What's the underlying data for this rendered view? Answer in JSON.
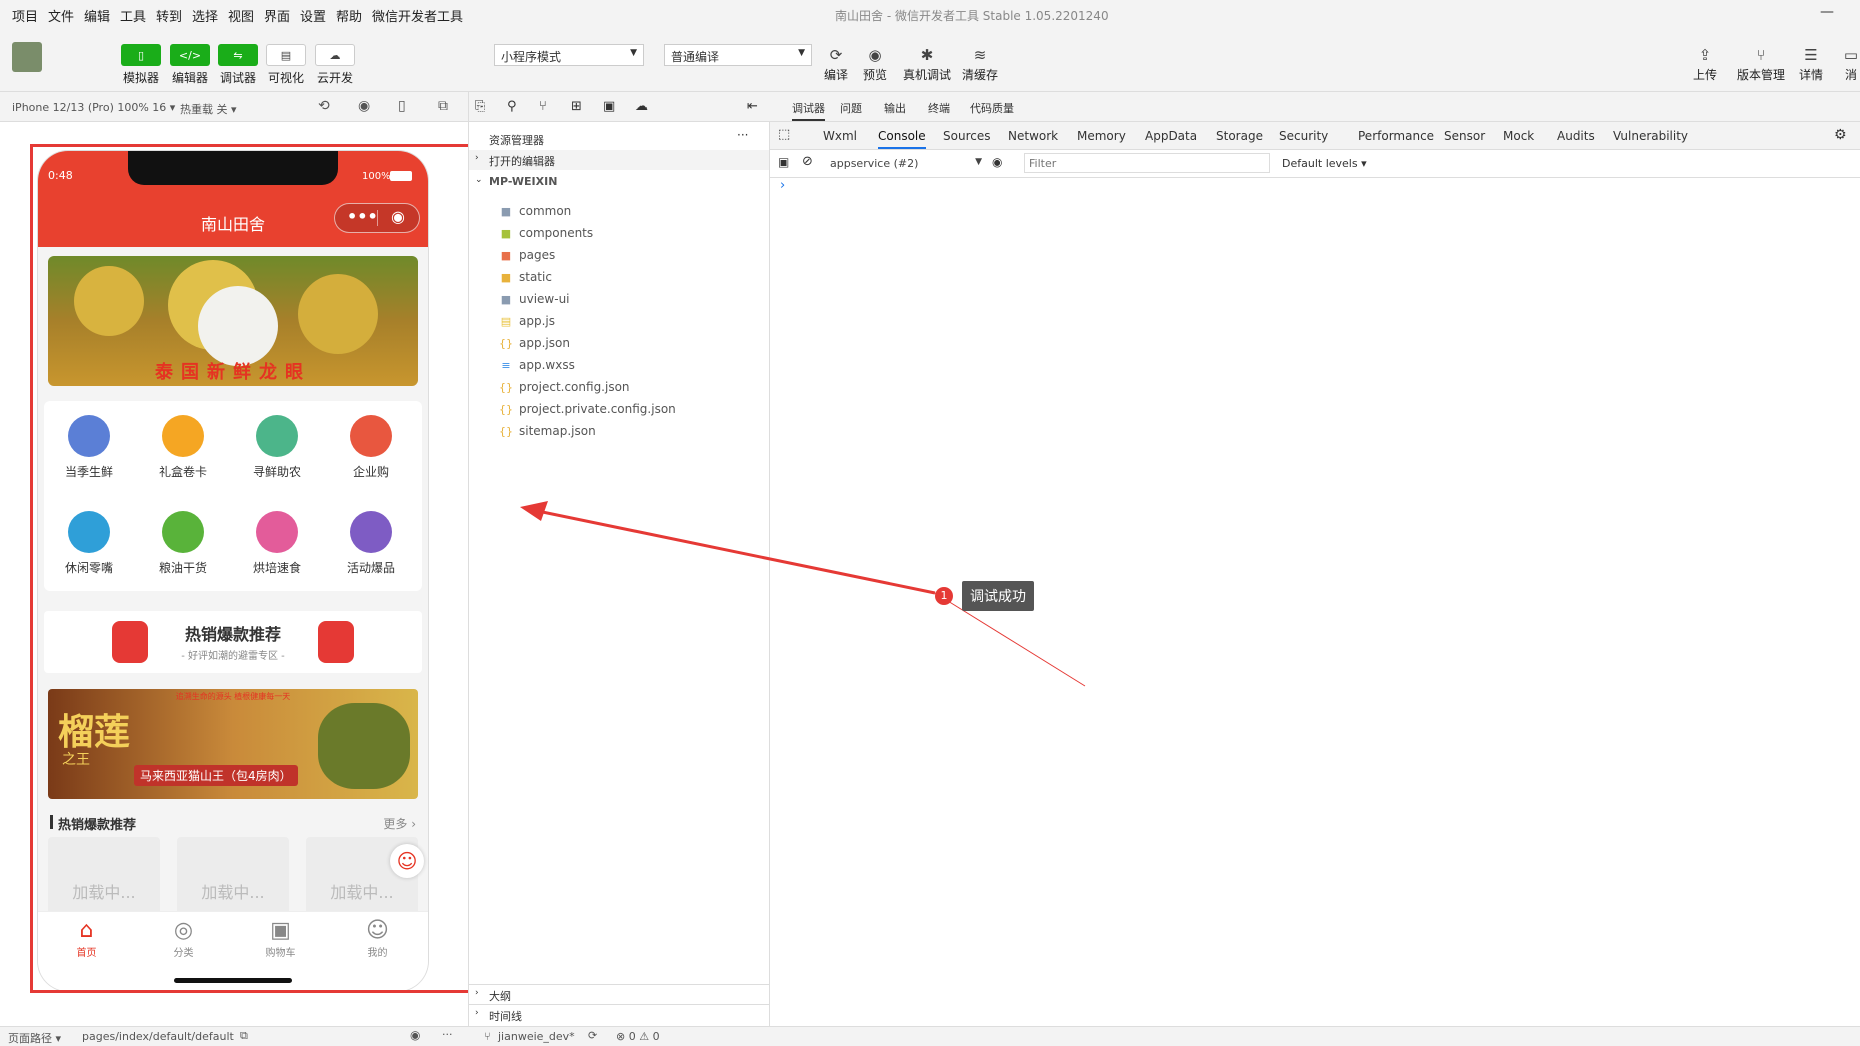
{
  "menu": [
    "项目",
    "文件",
    "编辑",
    "工具",
    "转到",
    "选择",
    "视图",
    "界面",
    "设置",
    "帮助",
    "微信开发者工具"
  ],
  "window_title": "南山田舍 - 微信开发者工具 Stable 1.05.2201240",
  "toolbar": {
    "simulator": "模拟器",
    "editor": "编辑器",
    "debugger": "调试器",
    "visual": "可视化",
    "cloud": "云开发",
    "mode_select": "小程序模式",
    "compile_select": "普通编译",
    "compile": "编译",
    "preview": "预览",
    "real_debug": "真机调试",
    "clear_cache": "清缓存",
    "upload": "上传",
    "version": "版本管理",
    "details": "详情",
    "msg": "消"
  },
  "sim_bar": {
    "device": "iPhone 12/13 (Pro) 100% 16 ▾",
    "hotreload": "热重载 关 ▾"
  },
  "phone": {
    "time": "0:48",
    "battery": "100%",
    "title": "南山田舍",
    "banner1_text": "泰国新鲜龙眼",
    "categories": [
      {
        "label": "当季生鲜",
        "color": "#5b7fd6"
      },
      {
        "label": "礼盒卷卡",
        "color": "#f5a623"
      },
      {
        "label": "寻鲜助农",
        "color": "#4cb58a"
      },
      {
        "label": "企业购",
        "color": "#e8573f"
      },
      {
        "label": "休闲零嘴",
        "color": "#2f9fd8"
      },
      {
        "label": "粮油干货",
        "color": "#59b33a"
      },
      {
        "label": "烘培速食",
        "color": "#e35c9a"
      },
      {
        "label": "活动爆品",
        "color": "#7e5cc4"
      }
    ],
    "hot_title": "热销爆款推荐",
    "hot_sub": "- 好评如潮的避雷专区 -",
    "banner2_top": "追溯生命的源头  植根健康每一天",
    "banner2_big": "榴莲",
    "banner2_small": "之王",
    "banner2_tag": "马来西亚猫山王（包4房肉）",
    "section_title": "热销爆款推荐",
    "more": "更多 ›",
    "loading": "加载中...",
    "tabs": [
      {
        "label": "首页",
        "icon": "⌂"
      },
      {
        "label": "分类",
        "icon": "◎"
      },
      {
        "label": "购物车",
        "icon": "▣"
      },
      {
        "label": "我的",
        "icon": "☺"
      }
    ]
  },
  "explorer": {
    "title": "资源管理器",
    "open_editors": "打开的编辑器",
    "root": "MP-WEIXIN",
    "files": [
      {
        "name": "common",
        "type": "folder",
        "color": "#8a9bb0"
      },
      {
        "name": "components",
        "type": "folder",
        "color": "#a6c23b"
      },
      {
        "name": "pages",
        "type": "folder",
        "color": "#e8704a"
      },
      {
        "name": "static",
        "type": "folder",
        "color": "#e8b23b"
      },
      {
        "name": "uview-ui",
        "type": "folder",
        "color": "#8a9bb0"
      },
      {
        "name": "app.js",
        "type": "js",
        "color": "#e8c23b"
      },
      {
        "name": "app.json",
        "type": "json",
        "color": "#e8b23b"
      },
      {
        "name": "app.wxss",
        "type": "wxss",
        "color": "#3b8fe8"
      },
      {
        "name": "project.config.json",
        "type": "json",
        "color": "#e8b23b"
      },
      {
        "name": "project.private.config.json",
        "type": "json",
        "color": "#e8b23b"
      },
      {
        "name": "sitemap.json",
        "type": "json",
        "color": "#e8b23b"
      }
    ],
    "outline": "大纲",
    "timeline": "时间线"
  },
  "devtools": {
    "top_tabs": [
      "调试器",
      "问题",
      "输出",
      "终端",
      "代码质量"
    ],
    "tabs": [
      "Wxml",
      "Console",
      "Sources",
      "Network",
      "Memory",
      "AppData",
      "Storage",
      "Security",
      "Performance",
      "Sensor",
      "Mock",
      "Audits",
      "Vulnerability"
    ],
    "context": "appservice (#2)",
    "filter_placeholder": "Filter",
    "levels": "Default levels ▾",
    "prompt": "›"
  },
  "annotation": {
    "num": "1",
    "text": "调试成功"
  },
  "status": {
    "path_label": "页面路径 ▾",
    "path": "pages/index/default/default",
    "branch": "jianweie_dev*",
    "errors": "⊗ 0 ⚠ 0"
  }
}
